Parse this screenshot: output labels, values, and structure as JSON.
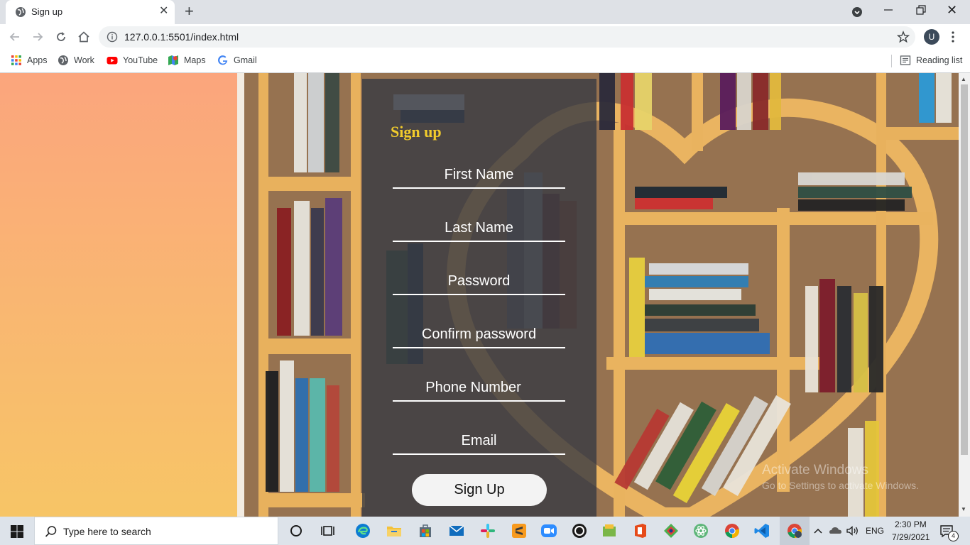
{
  "browser": {
    "tab_title": "Sign up",
    "new_tab_label": "+",
    "close_tab_label": "✕",
    "close_window_label": "✕",
    "url": "127.0.0.1:5501/index.html",
    "profile_initial": "U",
    "bookmarks": [
      {
        "label": "Apps",
        "icon": "apps-grid-icon"
      },
      {
        "label": "Work",
        "icon": "globe-icon"
      },
      {
        "label": "YouTube",
        "icon": "youtube-icon"
      },
      {
        "label": "Maps",
        "icon": "maps-icon"
      },
      {
        "label": "Gmail",
        "icon": "google-icon"
      }
    ],
    "reading_list": "Reading list"
  },
  "form": {
    "title": "Sign up",
    "fields": [
      {
        "placeholder": "First Name",
        "type": "text"
      },
      {
        "placeholder": "Last Name",
        "type": "text"
      },
      {
        "placeholder": "Password",
        "type": "password"
      },
      {
        "placeholder": "Confirm password",
        "type": "password"
      },
      {
        "placeholder": "Phone Number",
        "type": "tel"
      },
      {
        "placeholder": "Email",
        "type": "email"
      }
    ],
    "submit_label": "Sign Up"
  },
  "background_text": {
    "watermark_line1": "Activate Windows",
    "watermark_line2": "Go to Settings to activate Windows."
  },
  "taskbar": {
    "search_placeholder": "Type here to search",
    "language": "ENG",
    "time": "2:30 PM",
    "date": "7/29/2021",
    "notification_count": "4"
  },
  "colors": {
    "form_title": "#f2cc2c",
    "gradient_top": "#fba57d",
    "gradient_bottom": "#f7c566",
    "shelf_wood": "#e9b35f"
  }
}
